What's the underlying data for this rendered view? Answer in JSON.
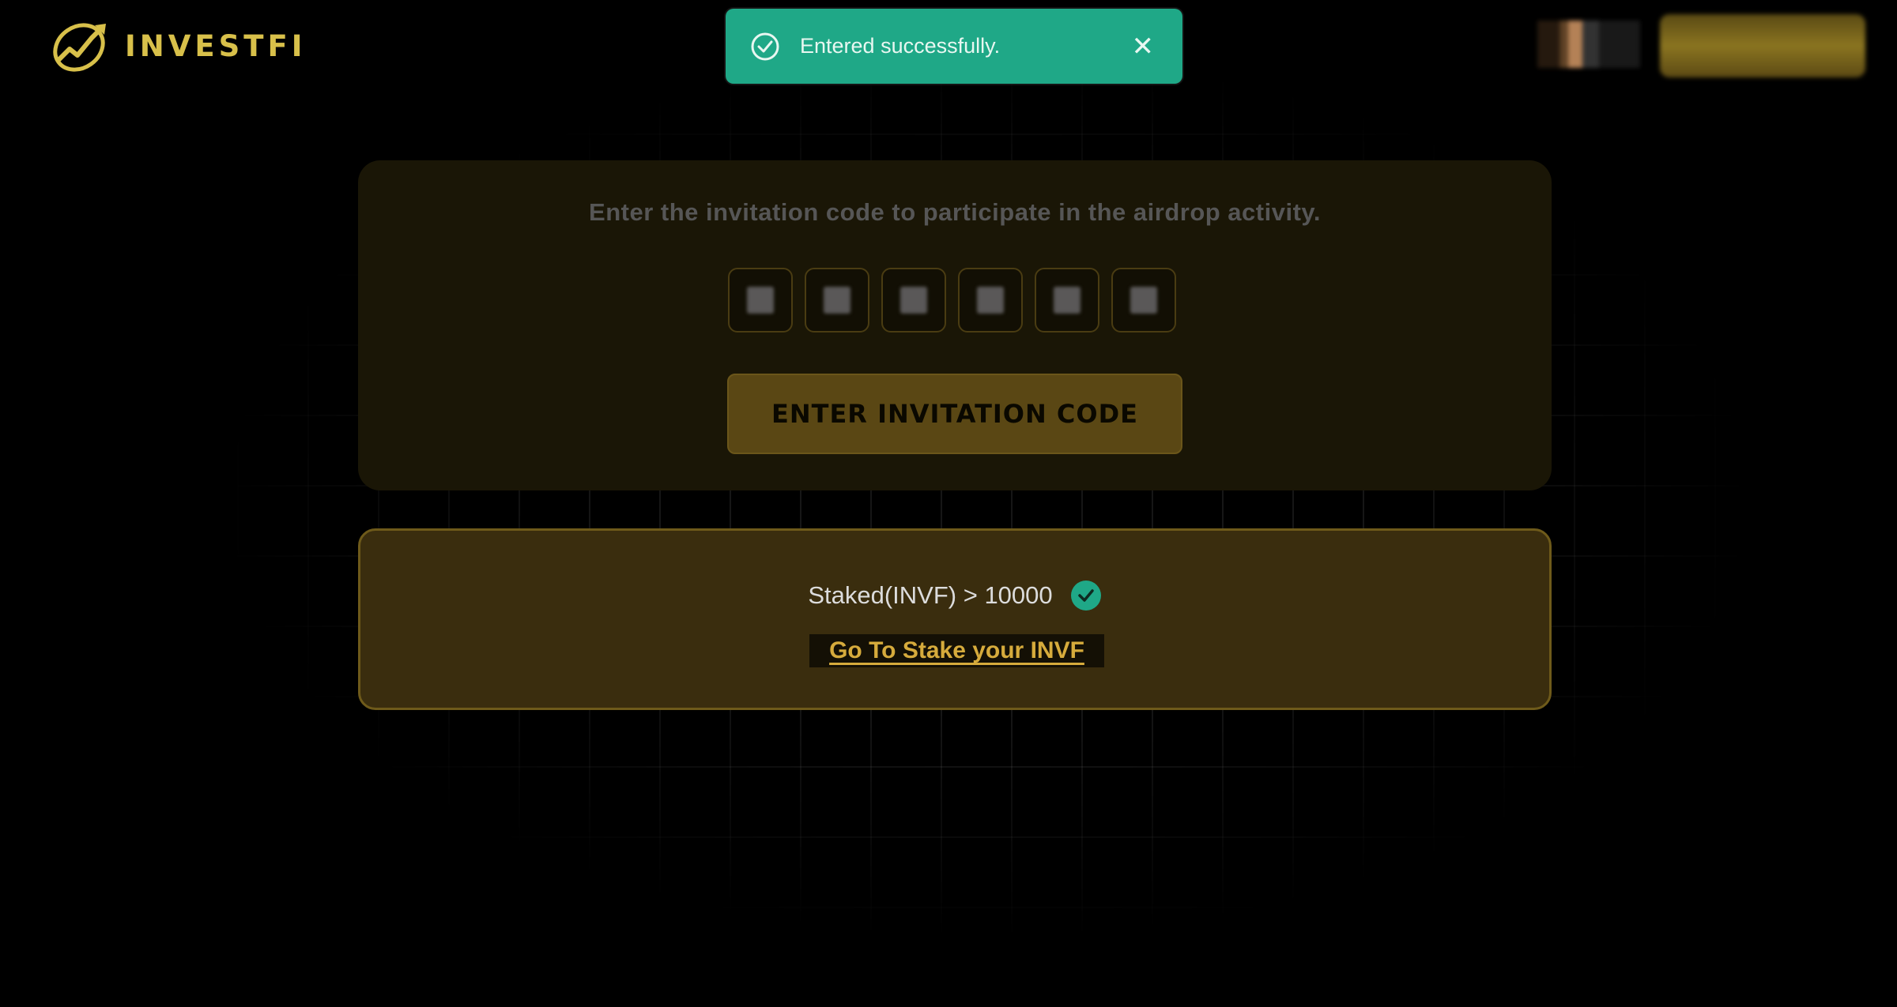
{
  "header": {
    "logo_text": "INVESTFI",
    "logo_icon": "chart-arrow-ring-logo",
    "avatar_icon": "user-avatar"
  },
  "toast": {
    "message": "Entered successfully.",
    "icon": "check-circle-icon",
    "close_glyph": "✕",
    "color": "#1fa887"
  },
  "invite": {
    "title": "Enter the invitation code to participate in the airdrop activity.",
    "button_label": "ENTER INVITATION CODE"
  },
  "staked": {
    "requirement": "Staked(INVF) > 10000",
    "status_icon": "check-circle-icon",
    "link_label": "Go To Stake your INVF"
  },
  "colors": {
    "background": "#000000",
    "accent_gold": "#d6ab3c",
    "success_green": "#1fa887"
  }
}
